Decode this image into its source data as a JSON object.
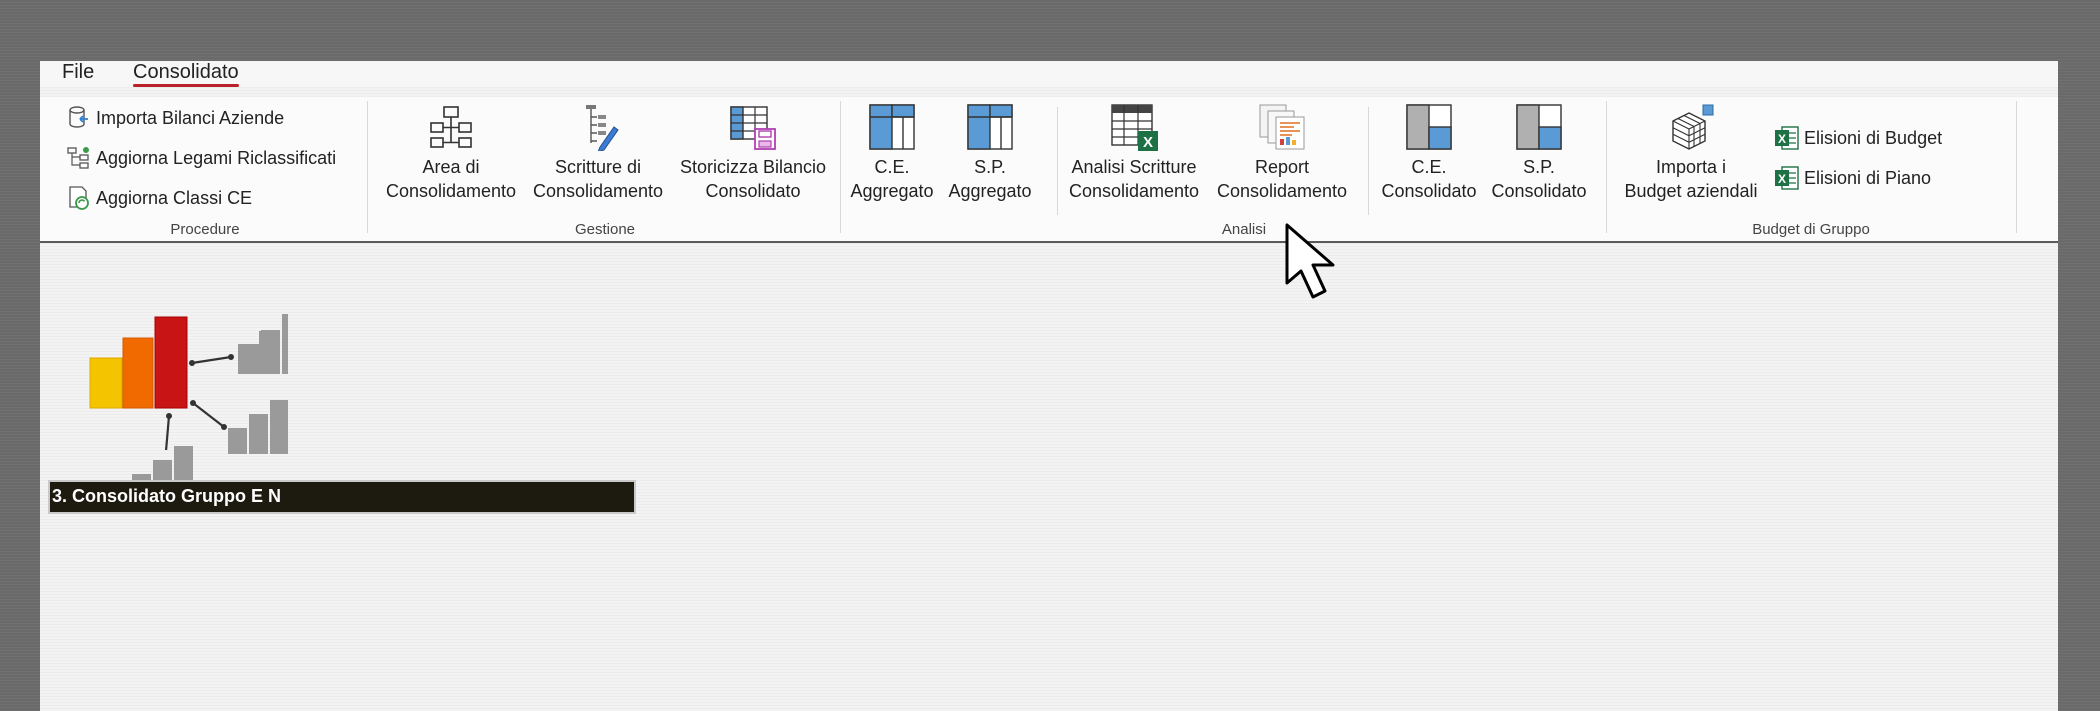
{
  "menu": {
    "file": "File",
    "consolidato": "Consolidato"
  },
  "ribbon": {
    "procedure": {
      "label": "Procedure",
      "items": [
        "Importa Bilanci Aziende",
        "Aggiorna Legami Riclassificati",
        "Aggiorna Classi CE"
      ]
    },
    "gestione": {
      "label": "Gestione",
      "buttons": [
        {
          "l1": "Area di",
          "l2": "Consolidamento"
        },
        {
          "l1": "Scritture di",
          "l2": "Consolidamento"
        },
        {
          "l1": "Storicizza Bilancio",
          "l2": "Consolidato"
        }
      ]
    },
    "analisi": {
      "label": "Analisi",
      "buttons": [
        {
          "l1": "C.E.",
          "l2": "Aggregato"
        },
        {
          "l1": "S.P.",
          "l2": "Aggregato"
        },
        {
          "l1": "Analisi Scritture",
          "l2": "Consolidamento"
        },
        {
          "l1": "Report",
          "l2": "Consolidamento"
        },
        {
          "l1": "C.E.",
          "l2": "Consolidato"
        },
        {
          "l1": "S.P.",
          "l2": "Consolidato"
        }
      ]
    },
    "budget": {
      "label": "Budget di Gruppo",
      "import": {
        "l1": "Importa i",
        "l2": "Budget aziendali"
      },
      "items": [
        "Elisioni di Budget",
        "Elisioni di Piano"
      ]
    }
  },
  "company": "3. Consolidato Gruppo E N",
  "colors": {
    "accent": "#b8202a",
    "excel": "#1e7145",
    "blue": "#5b9bd5"
  }
}
